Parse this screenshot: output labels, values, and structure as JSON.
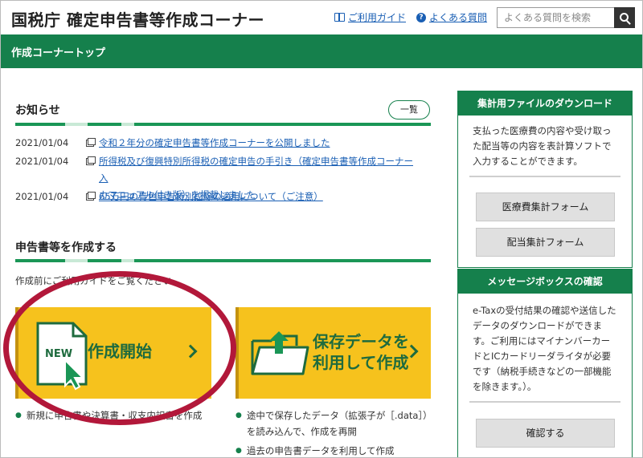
{
  "header": {
    "title": "国税庁 確定申告書等作成コーナー",
    "guide_link": "ご利用ガイド",
    "faq_link": "よくある質問",
    "search_placeholder": "よくある質問を検索"
  },
  "nav": {
    "title": "作成コーナートップ"
  },
  "news": {
    "heading": "お知らせ",
    "list_button": "一覧",
    "items": [
      {
        "date": "2021/01/04",
        "text": "令和２年分の確定申告書等作成コーナーを公開しました"
      },
      {
        "date": "2021/01/04",
        "text": "所得税及び復興特別所得税の確定申告の手引き（確定申告書等作成コーナー入力マニュアル付き版）を掲載しました",
        "line1": "所得税及び復興特別所得税の確定申告の手引き（確定申告書等作成コーナー入",
        "line2": "カマニュアル付き版）を掲載しました"
      },
      {
        "date": "2021/01/04",
        "text": "65万円の青色申告特別控除の適用について（ご注意）"
      }
    ]
  },
  "create": {
    "heading": "申告書等を作成する",
    "note": "作成前にご利用ガイドをご覧ください。",
    "start_card": {
      "badge": "NEW",
      "label": "作成開始"
    },
    "restore_card": {
      "line1": "保存データを",
      "line2": "利用して作成"
    },
    "start_bullets": [
      "新規に申告書や決算書・収支内訳書を作成"
    ],
    "restore_bullets": [
      "途中で保存したデータ（拡張子が［.data］）を読み込んで、作成を再開",
      "過去の申告書データを利用して作成"
    ]
  },
  "sidebar": {
    "download": {
      "heading": "集計用ファイルのダウンロード",
      "text": "支払った医療費の内容や受け取った配当等の内容を表計算ソフトで入力することができます。",
      "buttons": [
        "医療費集計フォーム",
        "配当集計フォーム"
      ]
    },
    "messagebox": {
      "heading": "メッセージボックスの確認",
      "text": "e-Taxの受付結果の確認や送信したデータのダウンロードができます。ご利用にはマイナンバーカードとICカードリーダライタが必要です（納税手続きなどの一部機能を除きます。）。",
      "button": "確認する"
    }
  },
  "colors": {
    "brand_green": "#15804c",
    "card_yellow": "#f6c21d",
    "annotation_red": "#b2183a",
    "link_blue": "#1a5fb4"
  }
}
